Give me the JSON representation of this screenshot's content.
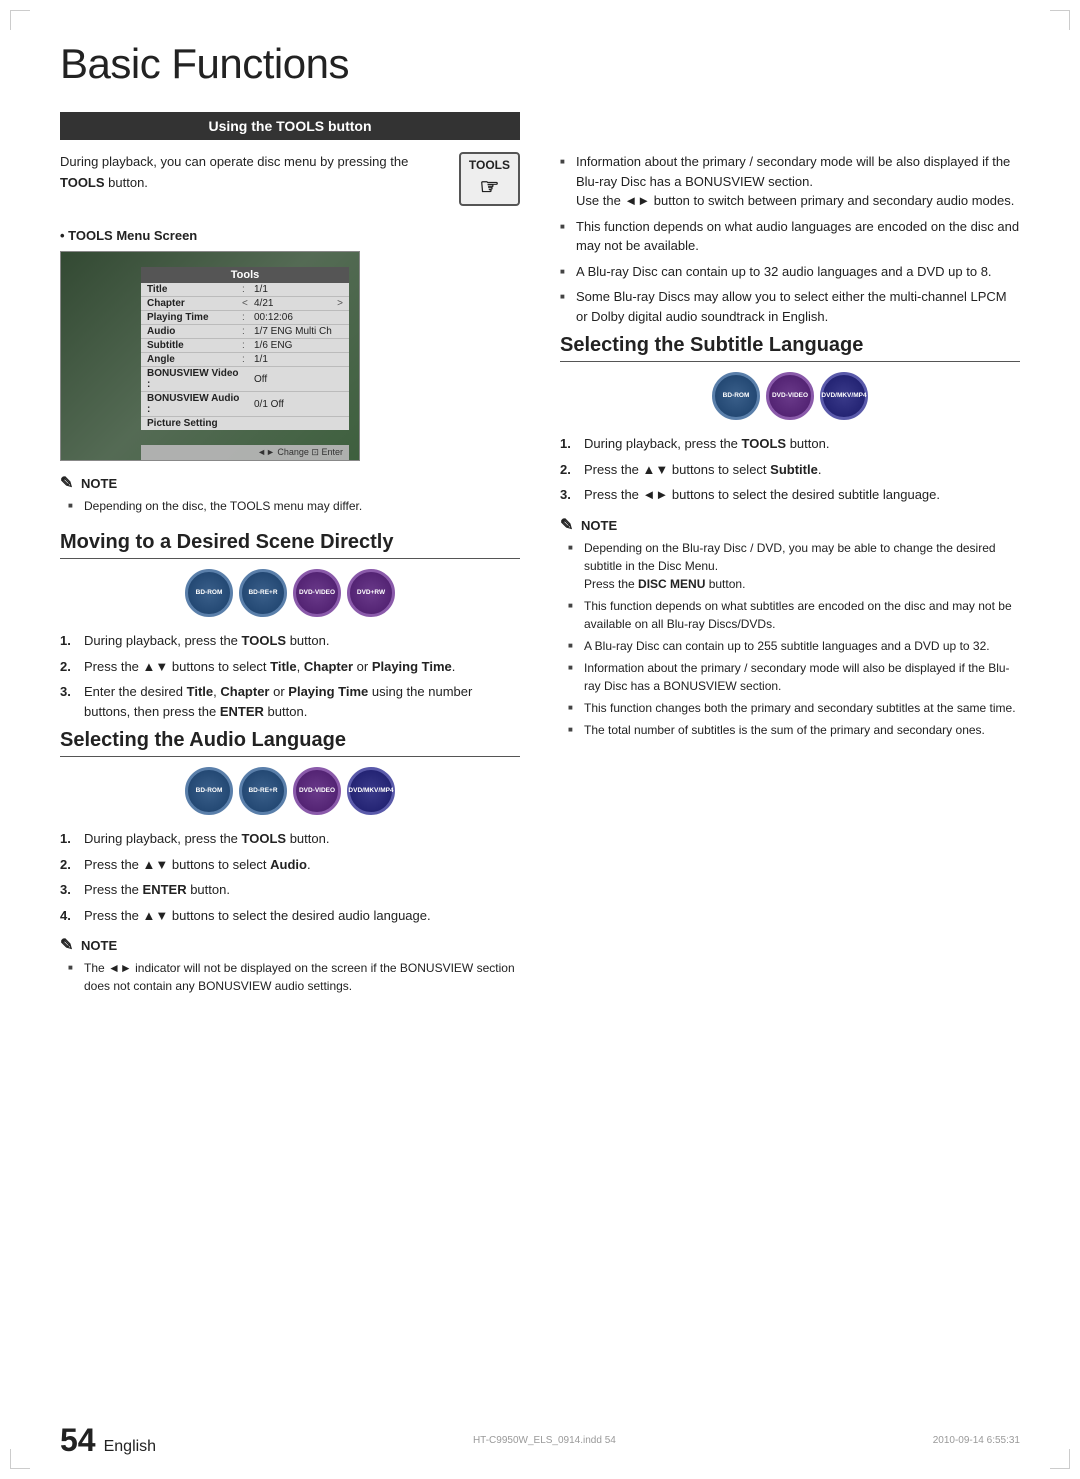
{
  "page": {
    "title": "Basic Functions",
    "page_number": "54",
    "language": "English",
    "footer_file": "HT-C9950W_ELS_0914.indd  54",
    "footer_date": "2010-09-14  6:55:31"
  },
  "left_col": {
    "tools_section": {
      "header": "Using the TOOLS button",
      "intro": "During playback, you can operate disc menu by pressing the",
      "intro_bold": "TOOLS",
      "intro_end": "button.",
      "tools_label": "TOOLS",
      "tools_menu_label": "TOOLS Menu Screen",
      "menu_title": "Tools",
      "menu_rows": [
        {
          "key": "Title",
          "sep": ":",
          "val": "1/1"
        },
        {
          "key": "Chapter",
          "sep": "<",
          "val": "4/21",
          "nav": ">"
        },
        {
          "key": "Playing Time",
          "sep": ":",
          "val": "00:12:06"
        },
        {
          "key": "Audio",
          "sep": ":",
          "val": "1/7 ENG Multi Ch"
        },
        {
          "key": "Subtitle",
          "sep": ":",
          "val": "1/6 ENG"
        },
        {
          "key": "Angle",
          "sep": ":",
          "val": "1/1"
        },
        {
          "key": "BONUSVIEW Video :",
          "sep": "",
          "val": "Off"
        },
        {
          "key": "BONUSVIEW Audio :",
          "sep": "",
          "val": "0/1 Off"
        },
        {
          "key": "Picture Setting",
          "sep": "",
          "val": ""
        }
      ],
      "menu_footer": "◄► Change  ⊡ Enter",
      "note_header": "NOTE",
      "note_items": [
        "Depending on the disc, the TOOLS menu may differ."
      ]
    },
    "moving_section": {
      "title": "Moving to a Desired Scene Directly",
      "disc_badges": [
        {
          "label": "BD-ROM",
          "type": "bd-rom"
        },
        {
          "label": "BD-RE+R",
          "type": "bd-re"
        },
        {
          "label": "DVD-VIDEO",
          "type": "dvd-video"
        },
        {
          "label": "DVD+RW",
          "type": "dvd-rw"
        }
      ],
      "steps": [
        {
          "num": "1.",
          "text": "During playback, press the ",
          "bold": "TOOLS",
          "rest": " button."
        },
        {
          "num": "2.",
          "text": "Press the ▲▼ buttons to select ",
          "bold": "Title",
          "rest": ", Chapter or Playing Time."
        },
        {
          "num": "3.",
          "text": "Enter the desired Title, Chapter or Playing Time using the number buttons, then press the ENTER button."
        }
      ],
      "step2_text": "Press the ▲▼ buttons to select Title, Chapter or Playing Time.",
      "step3_text": "Enter the desired Title, Chapter or Playing Time using the number buttons, then press the ENTER button."
    },
    "audio_section": {
      "title": "Selecting the Audio Language",
      "disc_badges": [
        {
          "label": "BD-ROM",
          "type": "bd-rom"
        },
        {
          "label": "BD-RE+R",
          "type": "bd-re"
        },
        {
          "label": "DVD-VIDEO",
          "type": "dvd-video"
        },
        {
          "label": "DVD/MKV/MP4",
          "type": "dvdmkmp"
        }
      ],
      "steps": [
        {
          "num": "1.",
          "text": "During playback, press the TOOLS button."
        },
        {
          "num": "2.",
          "text": "Press the ▲▼ buttons to select Audio."
        },
        {
          "num": "3.",
          "text": "Press the ENTER button."
        },
        {
          "num": "4.",
          "text": "Press the ▲▼ buttons to select the desired audio language."
        }
      ],
      "note_header": "NOTE",
      "note_items": [
        "The ◄► indicator will not be displayed on the screen if the BONUSVIEW section does not contain any BONUSVIEW audio settings."
      ]
    }
  },
  "right_col": {
    "audio_notes": {
      "items": [
        "Information about the primary / secondary mode will be also displayed if the Blu-ray Disc has a BONUSVIEW section. Use the ◄► button to switch between primary and secondary audio modes.",
        "This function depends on what audio languages are encoded on the disc and may not be available.",
        "A Blu-ray Disc can contain up to 32 audio languages and a DVD up to 8.",
        "Some Blu-ray Discs may allow you to select either the multi-channel LPCM or Dolby digital audio soundtrack in English."
      ]
    },
    "subtitle_section": {
      "title": "Selecting the Subtitle Language",
      "disc_badges": [
        {
          "label": "BD-ROM",
          "type": "bd-rom"
        },
        {
          "label": "DVD-VIDEO",
          "type": "dvd-video"
        },
        {
          "label": "DVD/MKV/MP4",
          "type": "dvdmkmp"
        }
      ],
      "steps": [
        {
          "num": "1.",
          "text": "During playback, press the TOOLS button."
        },
        {
          "num": "2.",
          "text": "Press the ▲▼ buttons to select Subtitle."
        },
        {
          "num": "3.",
          "text": "Press the ◄► buttons to select the desired subtitle language."
        }
      ],
      "note_header": "NOTE",
      "note_items": [
        "Depending on the Blu-ray Disc / DVD, you may be able to change the desired subtitle in the Disc Menu. Press the DISC MENU button.",
        "This function depends on what subtitles are encoded on the disc and may not be available on all Blu-ray Discs/DVDs.",
        "A Blu-ray Disc can contain up to 255 subtitle languages and a DVD up to 32.",
        "Information about the primary / secondary mode will also be displayed if the Blu-ray Disc has a BONUSVIEW section.",
        "This function changes both the primary and secondary subtitles at the same time.",
        "The total number of subtitles is the sum of the primary and secondary ones."
      ]
    }
  }
}
